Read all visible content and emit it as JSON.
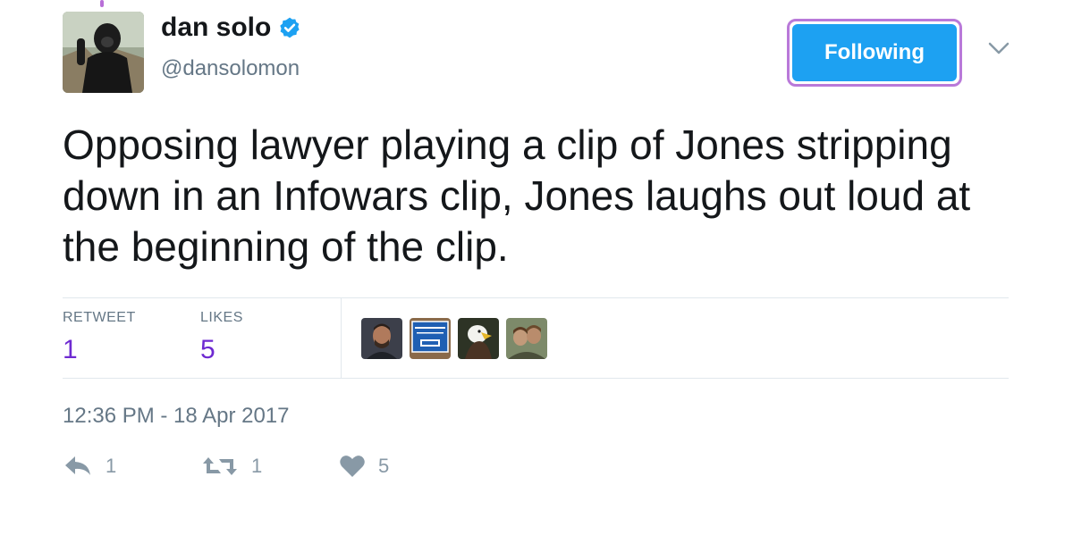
{
  "tweet": {
    "display_name": "dan solo",
    "handle": "@dansolomon",
    "follow_button_label": "Following",
    "text": "Opposing lawyer playing a clip of Jones stripping down in an Infowars clip, Jones laughs out loud at the beginning of the clip.",
    "timestamp": "12:36 PM - 18 Apr 2017",
    "verified": true
  },
  "stats": {
    "retweets_label": "RETWEET",
    "retweets_count": "1",
    "likes_label": "LIKES",
    "likes_count": "5"
  },
  "likers": [
    {
      "icon": "liker-avatar-man"
    },
    {
      "icon": "liker-avatar-trump-2017-sign",
      "text": "TRUMP 2017"
    },
    {
      "icon": "liker-avatar-eagle"
    },
    {
      "icon": "liker-avatar-people"
    }
  ],
  "actions": {
    "reply_count": "1",
    "retweet_count": "1",
    "like_count": "5"
  },
  "colors": {
    "accent": "#1da1f2",
    "focus_ring": "#b979d9",
    "stat_value": "#6e2ad1",
    "muted": "#657786"
  }
}
